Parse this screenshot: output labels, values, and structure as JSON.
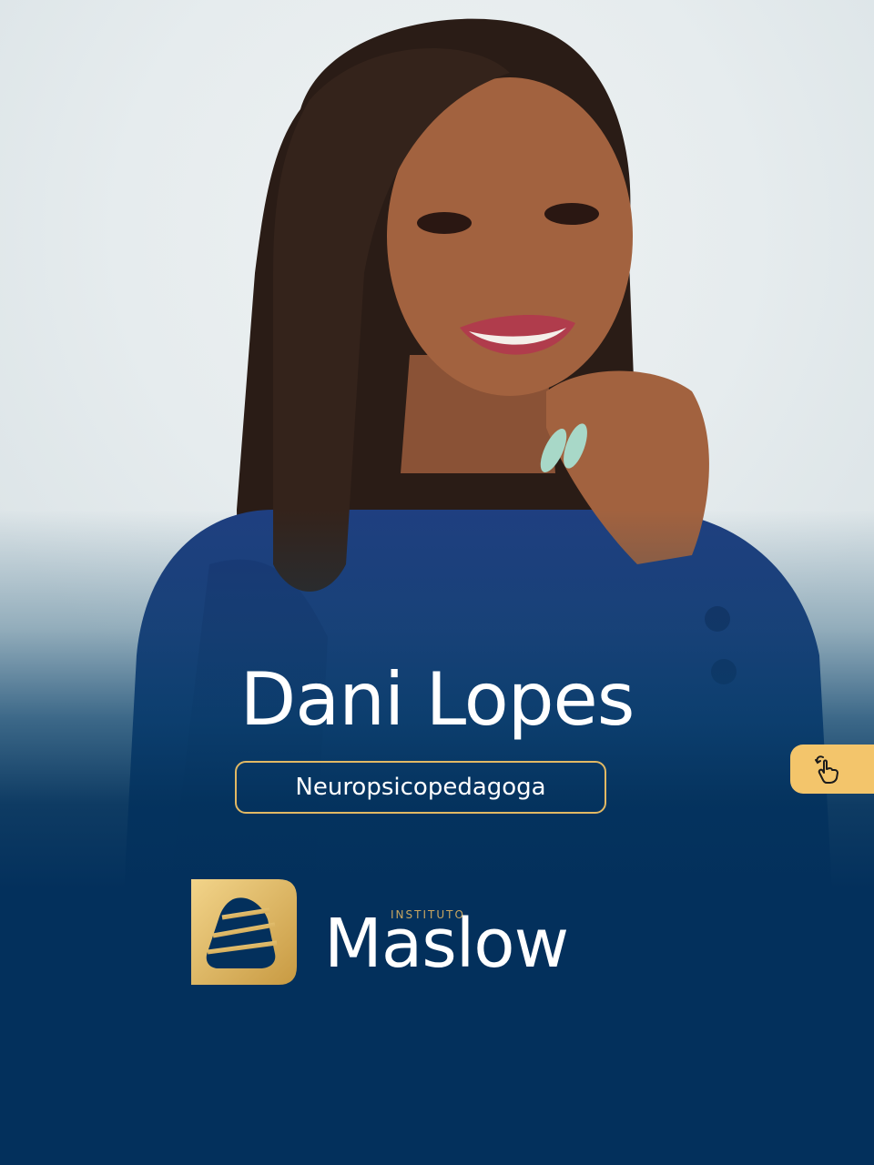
{
  "profile": {
    "name": "Dani Lopes",
    "role": "Neuropsicopedagoga"
  },
  "brand": {
    "small_label": "INSTITUTO",
    "name": "Maslow",
    "navy": "#03305c",
    "gold": "#e2b964",
    "swipe_bg": "#f3c56b"
  },
  "icons": {
    "swipe": "swipe-hand-icon",
    "logo": "maslow-pyramid-logo"
  }
}
